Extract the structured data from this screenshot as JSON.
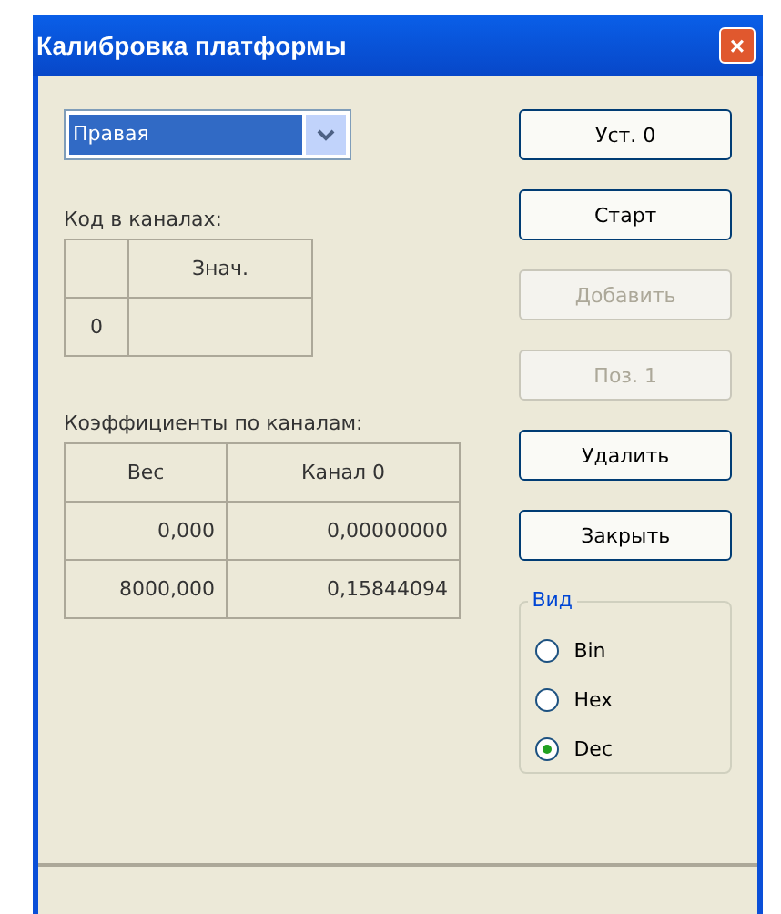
{
  "window": {
    "title": "Калибровка платформы",
    "close": "×"
  },
  "platform_select": {
    "value": "Правая",
    "selected": true
  },
  "code_label": "Код в каналах:",
  "code_table": {
    "columns": [
      "",
      "Знач."
    ],
    "rows": [
      [
        "0",
        ""
      ]
    ]
  },
  "coef_label": "Коэффициенты по каналам:",
  "coef_table": {
    "columns": [
      "Вес",
      "Канал 0"
    ],
    "rows": [
      [
        "0,000",
        "0,00000000"
      ],
      [
        "8000,000",
        "0,15844094"
      ]
    ]
  },
  "buttons": [
    {
      "label": "Уст. 0",
      "disabled": false
    },
    {
      "label": "Старт",
      "disabled": false
    },
    {
      "label": "Добавить",
      "disabled": true
    },
    {
      "label": "Поз. 1",
      "disabled": true
    },
    {
      "label": "Удалить",
      "disabled": false
    },
    {
      "label": "Закрыть",
      "disabled": false
    }
  ],
  "view_group": {
    "title": "Вид",
    "options": [
      {
        "label": "Bin",
        "selected": false
      },
      {
        "label": "Hex",
        "selected": false
      },
      {
        "label": "Dec",
        "selected": true
      }
    ]
  }
}
